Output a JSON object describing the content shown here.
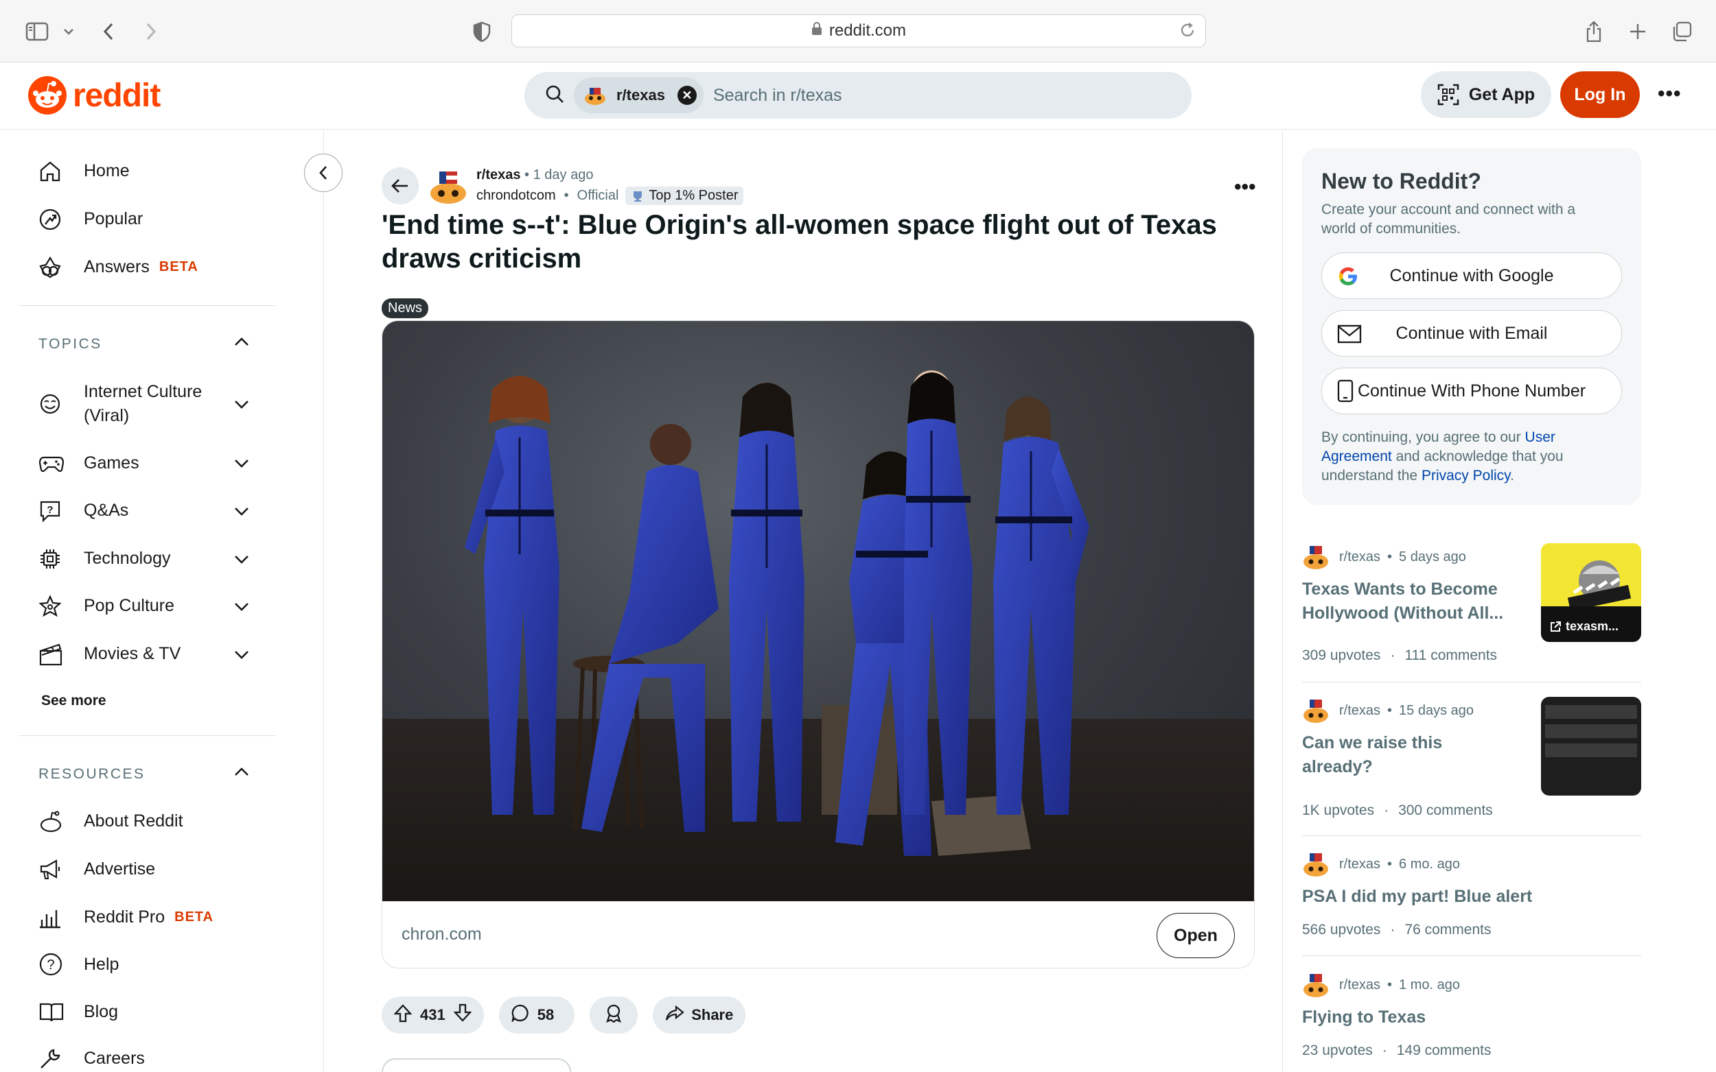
{
  "browser": {
    "url": "reddit.com"
  },
  "header": {
    "logo_text": "reddit",
    "search_chip": "r/texas",
    "search_placeholder": "Search in r/texas",
    "get_app": "Get App",
    "login": "Log In",
    "brand_color": "#ff4500"
  },
  "sidebar": {
    "main": [
      {
        "label": "Home",
        "icon": "home-icon"
      },
      {
        "label": "Popular",
        "icon": "popular-icon"
      },
      {
        "label": "Answers",
        "badge": "BETA",
        "icon": "answers-icon"
      }
    ],
    "topics_header": "TOPICS",
    "topics": [
      {
        "label": "Internet Culture (Viral)",
        "icon": "internet-culture-icon"
      },
      {
        "label": "Games",
        "icon": "games-icon"
      },
      {
        "label": "Q&As",
        "icon": "qa-icon"
      },
      {
        "label": "Technology",
        "icon": "technology-icon"
      },
      {
        "label": "Pop Culture",
        "icon": "pop-culture-icon"
      },
      {
        "label": "Movies & TV",
        "icon": "movies-icon"
      }
    ],
    "see_more": "See more",
    "resources_header": "RESOURCES",
    "resources": [
      {
        "label": "About Reddit",
        "icon": "about-icon"
      },
      {
        "label": "Advertise",
        "icon": "advertise-icon"
      },
      {
        "label": "Reddit Pro",
        "badge": "BETA",
        "icon": "reddit-pro-icon"
      },
      {
        "label": "Help",
        "icon": "help-icon"
      },
      {
        "label": "Blog",
        "icon": "blog-icon"
      },
      {
        "label": "Careers",
        "icon": "careers-icon"
      }
    ]
  },
  "post": {
    "subreddit": "r/texas",
    "time": "1 day ago",
    "author": "chrondotcom",
    "official": "Official",
    "flair": "Top 1% Poster",
    "title": "'End time s--t': Blue Origin's all-women space flight out of Texas draws criticism",
    "tag": "News",
    "domain": "chron.com",
    "open_label": "Open",
    "upvotes": "431",
    "comments": "58",
    "share": "Share"
  },
  "right": {
    "new_title": "New to Reddit?",
    "new_sub": "Create your account and connect with a world of communities.",
    "google": "Continue with Google",
    "email": "Continue with Email",
    "phone": "Continue With Phone Number",
    "legal_1": "By continuing, you agree to our ",
    "legal_link1": "User Agreement",
    "legal_2": " and acknowledge that you understand the ",
    "legal_link2": "Privacy Policy",
    "legal_3": ".",
    "posts": [
      {
        "sub": "r/texas",
        "time": "5 days ago",
        "title": "Texas Wants to Become Hollywood (Without All...",
        "upvotes": "309 upvotes",
        "comments": "111 comments",
        "thumb_label": "texasm..."
      },
      {
        "sub": "r/texas",
        "time": "15 days ago",
        "title": "Can we raise this already?",
        "upvotes": "1K upvotes",
        "comments": "300 comments"
      },
      {
        "sub": "r/texas",
        "time": "6 mo. ago",
        "title": "PSA I did my part! Blue alert",
        "upvotes": "566 upvotes",
        "comments": "76 comments"
      },
      {
        "sub": "r/texas",
        "time": "1 mo. ago",
        "title": "Flying to Texas",
        "upvotes": "23 upvotes",
        "comments": "149 comments"
      }
    ]
  }
}
